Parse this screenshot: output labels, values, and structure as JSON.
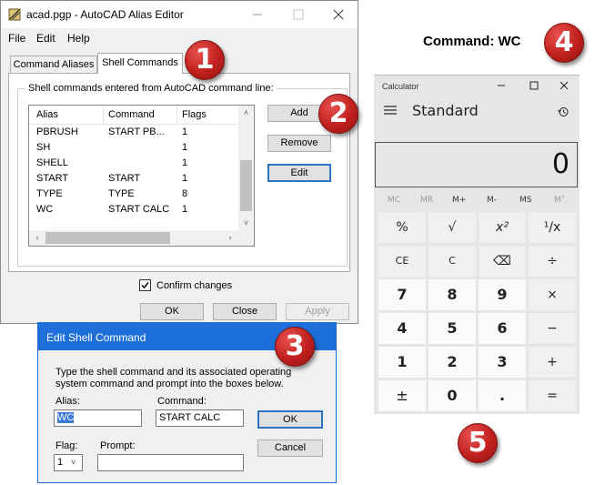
{
  "alias_editor": {
    "title": "acad.pgp - AutoCAD Alias Editor",
    "menu": [
      "File",
      "Edit",
      "Help"
    ],
    "tabs": [
      "Command Aliases",
      "Shell Commands"
    ],
    "group_label": "Shell commands entered from AutoCAD command line:",
    "columns": [
      "Alias",
      "Command",
      "Flags"
    ],
    "rows": [
      {
        "alias": "PBRUSH",
        "command": "START PB...",
        "flags": "1"
      },
      {
        "alias": "SH",
        "command": "",
        "flags": "1"
      },
      {
        "alias": "SHELL",
        "command": "",
        "flags": "1"
      },
      {
        "alias": "START",
        "command": "START",
        "flags": "1"
      },
      {
        "alias": "TYPE",
        "command": "TYPE",
        "flags": "8"
      },
      {
        "alias": "WC",
        "command": "START CALC",
        "flags": "1"
      }
    ],
    "buttons": {
      "add": "Add",
      "remove": "Remove",
      "edit": "Edit"
    },
    "confirm_label": "Confirm changes",
    "confirm_checked": true,
    "footer": {
      "ok": "OK",
      "close": "Close",
      "apply": "Apply"
    }
  },
  "edit_dialog": {
    "title": "Edit Shell Command",
    "instructions_1": "Type the shell command and its associated operating",
    "instructions_2": "system command and prompt into the boxes below.",
    "alias_label": "Alias:",
    "alias_value": "WC",
    "command_label": "Command:",
    "command_value": "START CALC",
    "flag_label": "Flag:",
    "flag_value": "1",
    "prompt_label": "Prompt:",
    "prompt_value": "",
    "ok": "OK",
    "cancel": "Cancel"
  },
  "command_label": "Command: WC",
  "calculator": {
    "title": "Calculator",
    "mode": "Standard",
    "display": "0",
    "memory": [
      "MC",
      "MR",
      "M+",
      "M-",
      "MS",
      "M˅"
    ],
    "keys": [
      [
        "%",
        "√",
        "x²",
        "¹/x"
      ],
      [
        "CE",
        "C",
        "⌫",
        "÷"
      ],
      [
        "7",
        "8",
        "9",
        "×"
      ],
      [
        "4",
        "5",
        "6",
        "−"
      ],
      [
        "1",
        "2",
        "3",
        "+"
      ],
      [
        "±",
        "0",
        ".",
        "="
      ]
    ]
  },
  "badges": [
    "1",
    "2",
    "3",
    "4",
    "5"
  ],
  "colors": {
    "focus_blue": "#2f73c5",
    "dialog_title": "#1e6fd9",
    "badge_red": "#c0201d"
  }
}
